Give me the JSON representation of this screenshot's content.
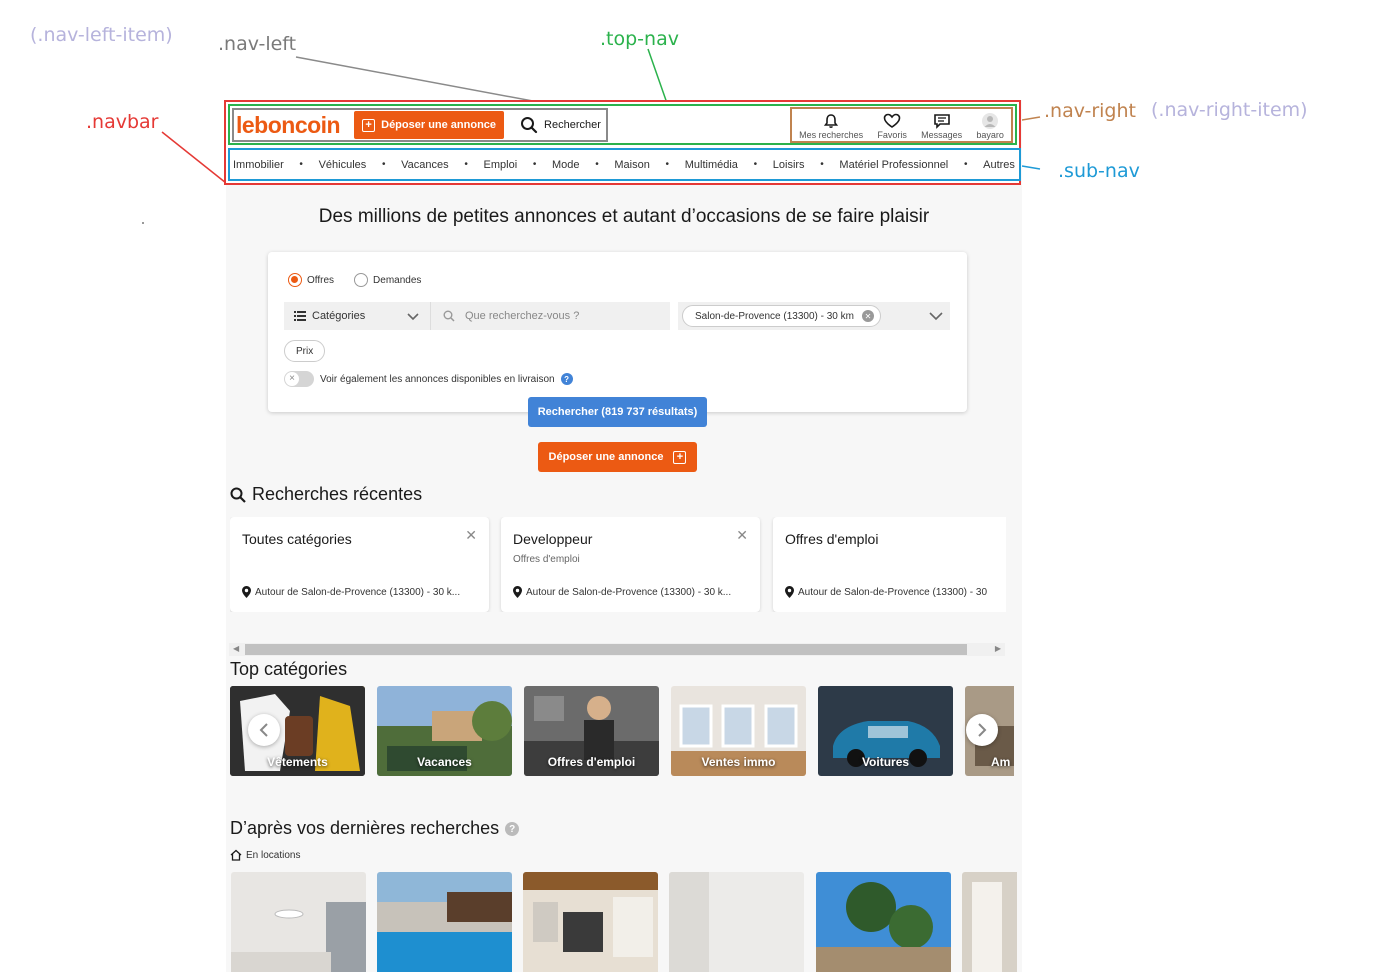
{
  "annotations": {
    "nav_left_item": "(.nav-left-item)",
    "nav_left": ".nav-left",
    "top_nav": ".top-nav",
    "navbar": ".navbar",
    "nav_right": ".nav-right",
    "nav_right_item": "(.nav-right-item)",
    "sub_nav": ".sub-nav",
    "colors": {
      "navbar": "#e53935",
      "top_nav": "#2bb24c",
      "nav_left": "#8a8a8a",
      "nav_right": "#c0834f",
      "sub_nav": "#1e9ad6",
      "item_hint": "#b6b3dc"
    }
  },
  "brand": {
    "logo": "leboncoin",
    "accent": "#ec5a13",
    "blue": "#4183d7"
  },
  "nav": {
    "deposit_label": "Déposer une annonce",
    "search_label": "Rechercher",
    "right_items": [
      {
        "label": "Mes recherches",
        "icon": "bell-icon"
      },
      {
        "label": "Favoris",
        "icon": "heart-icon"
      },
      {
        "label": "Messages",
        "icon": "message-icon"
      },
      {
        "label": "bayaro",
        "icon": "user-avatar-icon"
      }
    ],
    "categories": [
      "Immobilier",
      "Véhicules",
      "Vacances",
      "Emploi",
      "Mode",
      "Maison",
      "Multimédia",
      "Loisirs",
      "Matériel Professionnel",
      "Autres"
    ]
  },
  "hero": {
    "title": "Des millions de petites annonces et autant d’occasions de se faire plaisir"
  },
  "search": {
    "offer_label": "Offres",
    "demand_label": "Demandes",
    "selected": "Offres",
    "categories_label": "Catégories",
    "query_placeholder": "Que recherchez-vous ?",
    "location_chip": "Salon-de-Provence (13300) - 30 km",
    "price_label": "Prix",
    "delivery_toggle_label": "Voir également les annonces disponibles en livraison",
    "delivery_toggle_on": false,
    "submit_label": "Rechercher (819 737 résultats)",
    "deposit_label": "Déposer une annonce"
  },
  "recent": {
    "title": "Recherches récentes",
    "cards": [
      {
        "title": "Toutes catégories",
        "subtitle": "",
        "location": "Autour de Salon-de-Provence (13300) - 30 k..."
      },
      {
        "title": "Developpeur",
        "subtitle": "Offres d'emploi",
        "location": "Autour de Salon-de-Provence (13300) - 30 k..."
      },
      {
        "title": "Offres d'emploi",
        "subtitle": "",
        "location": "Autour de Salon-de-Provence (13300) - 30"
      }
    ]
  },
  "top_categories": {
    "title": "Top catégories",
    "tiles": [
      "Vêtements",
      "Vacances",
      "Offres d'emploi",
      "Ventes immo",
      "Voitures",
      "Am"
    ]
  },
  "latest": {
    "title": "D’après vos dernières recherches",
    "help": "?",
    "sub_label": "En locations"
  }
}
